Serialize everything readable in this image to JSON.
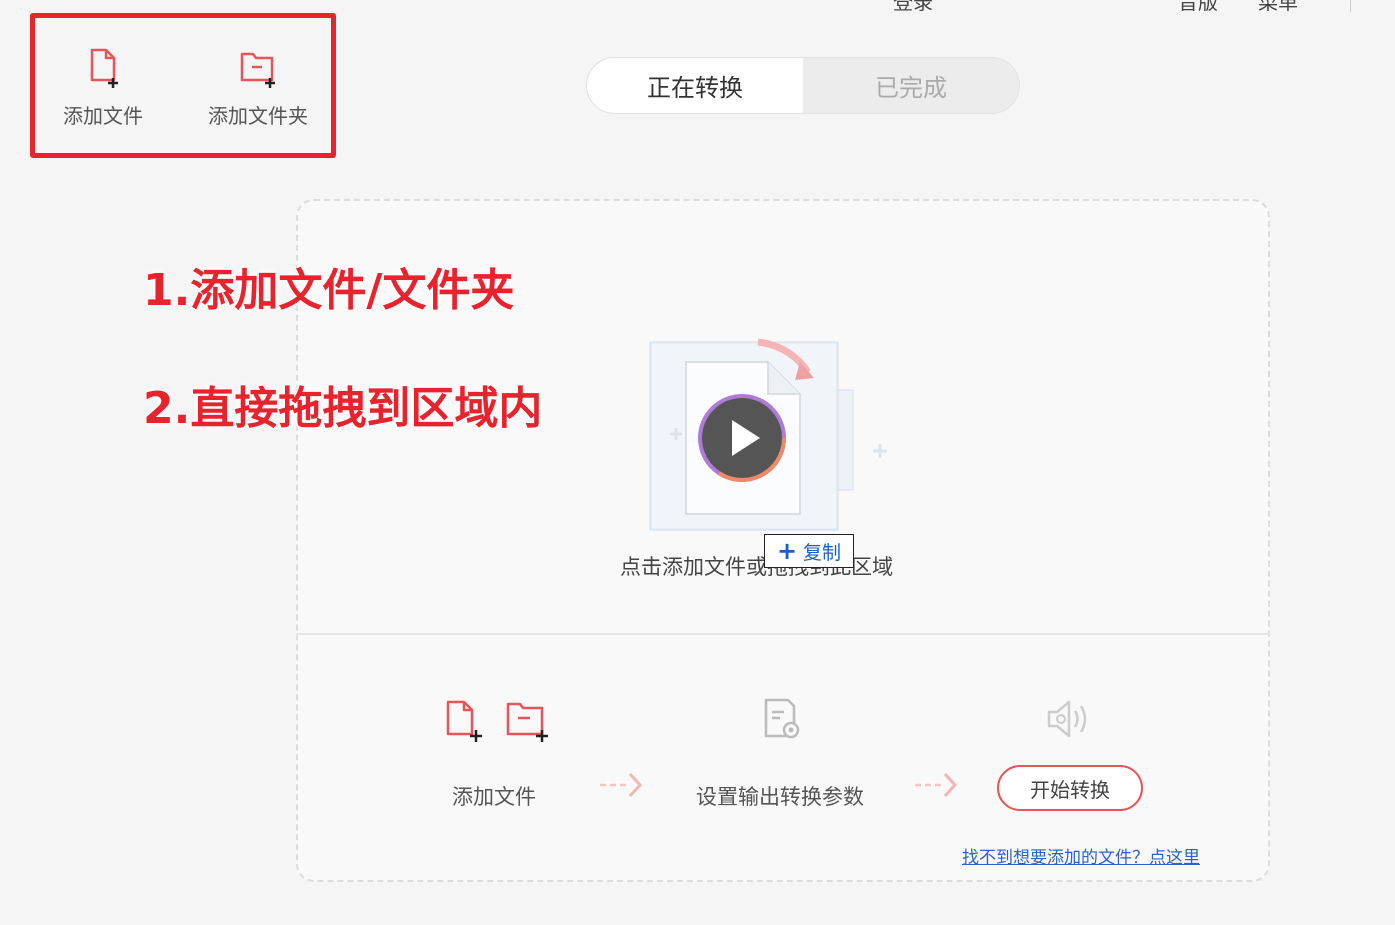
{
  "topbar": {
    "login": "登录",
    "more": "音版",
    "menu": "菜单"
  },
  "toolbar": {
    "add_file": "添加文件",
    "add_folder": "添加文件夹"
  },
  "tabs": {
    "converting": "正在转换",
    "completed": "已完成"
  },
  "annotations": {
    "step1": "1.添加文件/文件夹",
    "step2": "2.直接拖拽到区域内"
  },
  "drop_zone": {
    "hint": "点击添加文件或拖拽到此区域",
    "copy_badge": "复制"
  },
  "steps": {
    "add_file": "添加文件",
    "set_params": "设置输出转换参数"
  },
  "actions": {
    "start": "开始转换",
    "help_link": "找不到想要添加的文件？点这里"
  },
  "colors": {
    "accent": "#e8232e",
    "icon_red": "#e8545c",
    "link": "#2a62c9"
  }
}
